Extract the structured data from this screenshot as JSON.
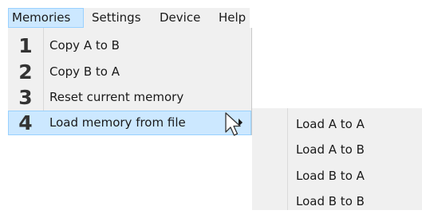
{
  "menubar": {
    "items": [
      {
        "label": "Memories",
        "active": true
      },
      {
        "label": "Settings"
      },
      {
        "label": "Device"
      },
      {
        "label": "Help"
      }
    ]
  },
  "memories_menu": {
    "items": [
      {
        "number": "1",
        "label": "Copy A to B"
      },
      {
        "number": "2",
        "label": "Copy B to A"
      },
      {
        "number": "3",
        "label": "Reset current memory"
      },
      {
        "number": "4",
        "label": "Load memory from file",
        "has_submenu": true,
        "highlighted": true
      }
    ]
  },
  "load_submenu": {
    "items": [
      {
        "label": "Load A to A"
      },
      {
        "label": "Load A to B"
      },
      {
        "label": "Load B to A"
      },
      {
        "label": "Load B to B"
      }
    ]
  },
  "colors": {
    "menu_background": "#f0f0f0",
    "highlight_fill": "#cce8ff",
    "highlight_border": "#99d1ff"
  },
  "icons": {
    "submenu_indicator": "chevron-right-icon",
    "cursor": "mouse-pointer-icon"
  }
}
